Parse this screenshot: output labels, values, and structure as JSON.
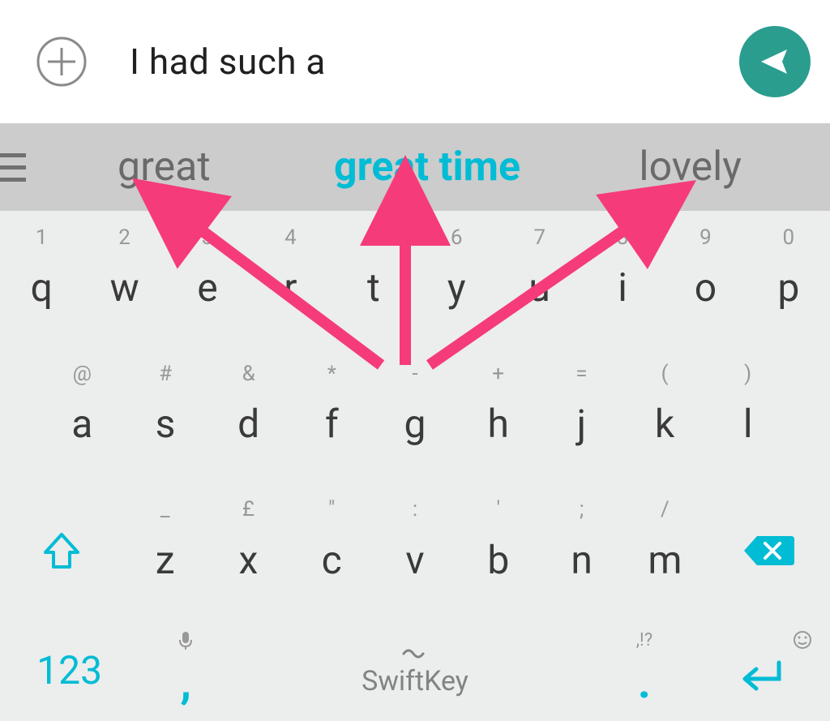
{
  "input": {
    "text": "I had such a"
  },
  "suggestions": {
    "left": "great",
    "center": "great time",
    "right": "lovely"
  },
  "keyboard": {
    "row1": [
      {
        "hint": "1",
        "main": "q"
      },
      {
        "hint": "2",
        "main": "w"
      },
      {
        "hint": "3",
        "main": "e"
      },
      {
        "hint": "4",
        "main": "r"
      },
      {
        "hint": "5",
        "main": "t"
      },
      {
        "hint": "6",
        "main": "y"
      },
      {
        "hint": "7",
        "main": "u"
      },
      {
        "hint": "8",
        "main": "i"
      },
      {
        "hint": "9",
        "main": "o"
      },
      {
        "hint": "0",
        "main": "p"
      }
    ],
    "row2": [
      {
        "hint": "@",
        "main": "a"
      },
      {
        "hint": "#",
        "main": "s"
      },
      {
        "hint": "&",
        "main": "d"
      },
      {
        "hint": "*",
        "main": "f"
      },
      {
        "hint": "-",
        "main": "g"
      },
      {
        "hint": "+",
        "main": "h"
      },
      {
        "hint": "=",
        "main": "j"
      },
      {
        "hint": "(",
        "main": "k"
      },
      {
        "hint": ")",
        "main": "l"
      }
    ],
    "row3": [
      {
        "hint": "_",
        "main": "z"
      },
      {
        "hint": "£",
        "main": "x"
      },
      {
        "hint": "\"",
        "main": "c"
      },
      {
        "hint": ":",
        "main": "v"
      },
      {
        "hint": "'",
        "main": "b"
      },
      {
        "hint": ";",
        "main": "n"
      },
      {
        "hint": "/",
        "main": "m"
      }
    ],
    "numeric_key": "123",
    "comma_hint": "mic-icon",
    "comma_main": ",",
    "spacebar": "SwiftKey",
    "period_hint": ",!?",
    "period_main": ".",
    "emoji_hint": "emoji-icon"
  },
  "colors": {
    "accent": "#00bcd4",
    "send": "#2a9d8f",
    "arrow": "#f53b7a"
  }
}
